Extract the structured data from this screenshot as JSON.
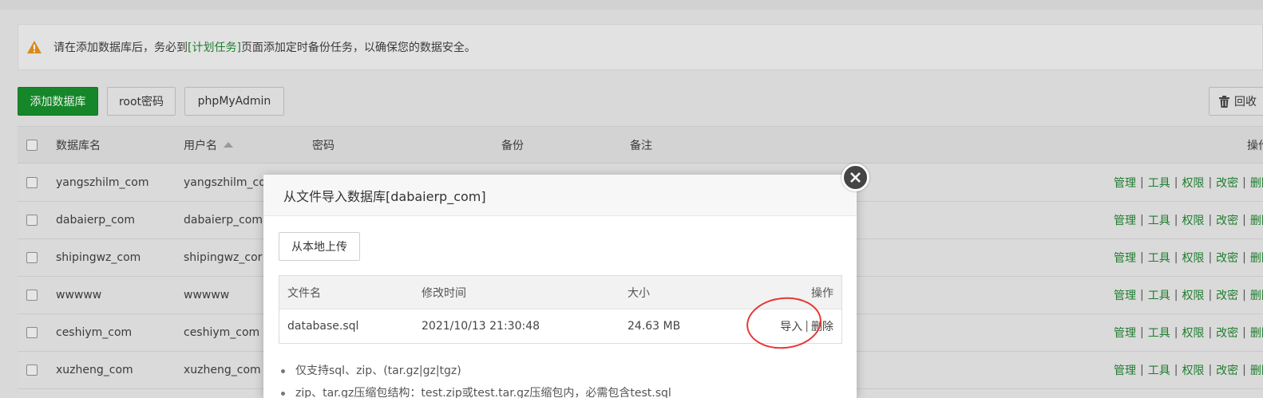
{
  "notice": {
    "pre": "请在添加数据库后，务必到",
    "link": "[计划任务]",
    "post": "页面添加定时备份任务，以确保您的数据安全。"
  },
  "toolbar": {
    "add_db": "添加数据库",
    "root_pwd": "root密码",
    "phpmyadmin": "phpMyAdmin",
    "recycle": "回收"
  },
  "table": {
    "headers": {
      "name": "数据库名",
      "user": "用户名",
      "password": "密码",
      "backup": "备份",
      "note": "备注",
      "ops": "操作"
    },
    "rows": [
      {
        "name": "yangszhilm_com",
        "user": "yangszhilm_co"
      },
      {
        "name": "dabaierp_com",
        "user": "dabaierp_com"
      },
      {
        "name": "shipingwz_com",
        "user": "shipingwz_cor"
      },
      {
        "name": "wwwww",
        "user": "wwwww"
      },
      {
        "name": "ceshiym_com",
        "user": "ceshiym_com"
      },
      {
        "name": "xuzheng_com",
        "user": "xuzheng_com"
      }
    ],
    "ops": [
      "管理",
      "工具",
      "权限",
      "改密",
      "删除"
    ]
  },
  "modal": {
    "title": "从文件导入数据库[dabaierp_com]",
    "upload_btn": "从本地上传",
    "file_table": {
      "headers": {
        "name": "文件名",
        "mtime": "修改时间",
        "size": "大小",
        "ops": "操作"
      },
      "row": {
        "name": "database.sql",
        "mtime": "2021/10/13 21:30:48",
        "size": "24.63 MB",
        "import": "导入",
        "delete": "删除"
      }
    },
    "notes": [
      "仅支持sql、zip、(tar.gz|gz|tgz)",
      "zip、tar.gz压缩包结构：test.zip或test.tar.gz压缩包内，必需包含test.sql"
    ]
  },
  "colors": {
    "green_btn": "#16862a",
    "link_green": "#20a53a",
    "annotation_red": "#e53935"
  },
  "icons": {
    "warning": "warning-icon",
    "close": "close-icon",
    "trash": "trash-icon"
  }
}
